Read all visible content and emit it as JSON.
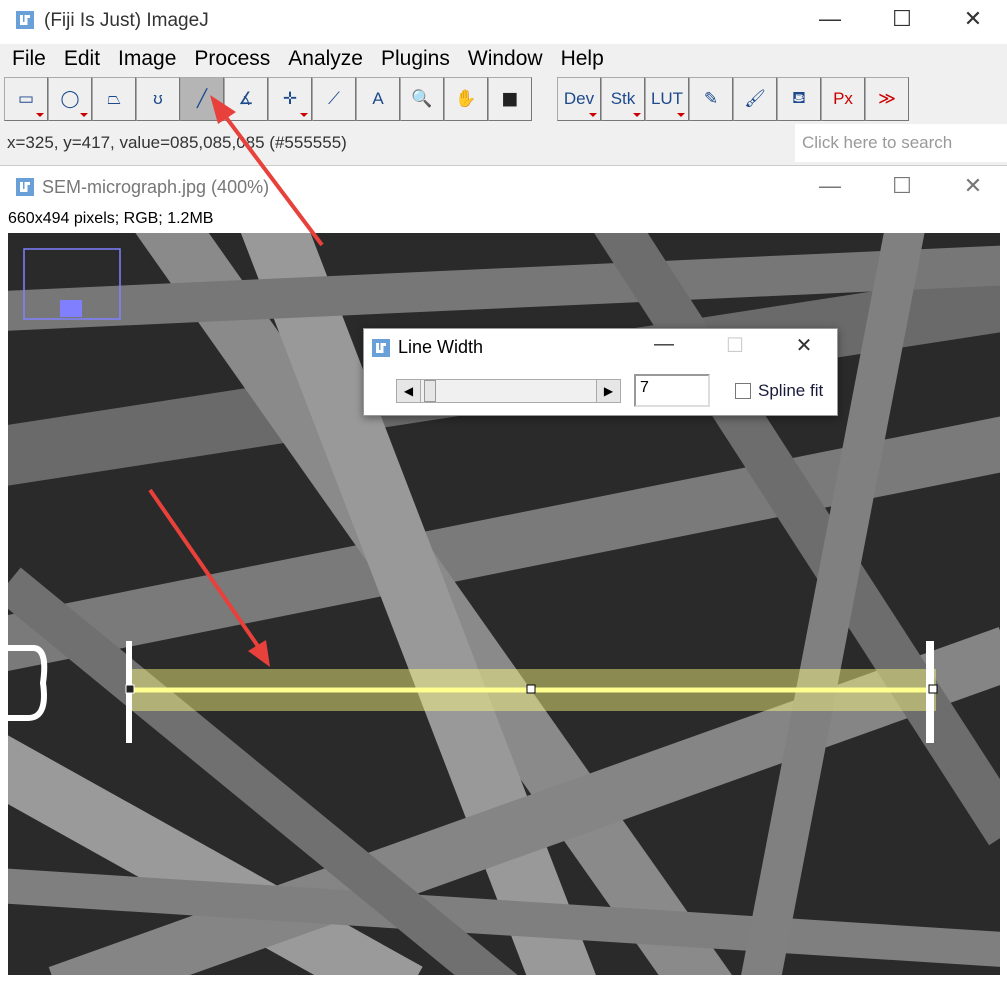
{
  "main_window": {
    "title": "(Fiji Is Just) ImageJ",
    "controls": {
      "minimize": "—",
      "maximize": "☐",
      "close": "✕"
    }
  },
  "menu": [
    "File",
    "Edit",
    "Image",
    "Process",
    "Analyze",
    "Plugins",
    "Window",
    "Help"
  ],
  "toolbar": [
    {
      "name": "rectangle-tool",
      "glyph": "▭",
      "dd": true
    },
    {
      "name": "oval-tool",
      "glyph": "◯",
      "dd": true
    },
    {
      "name": "polygon-tool",
      "glyph": "⏢",
      "dd": false
    },
    {
      "name": "freehand-tool",
      "glyph": "ʊ",
      "dd": false
    },
    {
      "name": "line-tool",
      "glyph": "╱",
      "dd": false,
      "selected": true
    },
    {
      "name": "angle-tool",
      "glyph": "∡",
      "dd": false
    },
    {
      "name": "multipoint-tool",
      "glyph": "✛",
      "dd": true
    },
    {
      "name": "wand-tool",
      "glyph": "⟋",
      "dd": false
    },
    {
      "name": "text-tool",
      "glyph": "A",
      "dd": false
    },
    {
      "name": "magnifier-tool",
      "glyph": "🔍",
      "dd": false
    },
    {
      "name": "hand-tool",
      "glyph": "✋",
      "dd": false
    },
    {
      "name": "color-picker-tool",
      "glyph": "■",
      "dd": false
    }
  ],
  "toolbar2": [
    {
      "name": "dev-menu",
      "glyph": "Dev",
      "dd": true
    },
    {
      "name": "stk-menu",
      "glyph": "Stk",
      "dd": true
    },
    {
      "name": "lut-menu",
      "glyph": "LUT",
      "dd": true
    },
    {
      "name": "pencil-tool",
      "glyph": "✎",
      "dd": false
    },
    {
      "name": "brush-tool",
      "glyph": "🖌",
      "dd": false
    },
    {
      "name": "flood-fill-tool",
      "glyph": "⛾",
      "dd": false
    },
    {
      "name": "pixel-inspector-tool",
      "glyph": "Px",
      "dd": false
    },
    {
      "name": "more-tools",
      "glyph": "≫",
      "dd": false
    }
  ],
  "status": "x=325, y=417, value=085,085,085 (#555555)",
  "search": {
    "placeholder": "Click here to search"
  },
  "image_window": {
    "title": "SEM-micrograph.jpg (400%)",
    "info": "660x494 pixels; RGB; 1.2MB"
  },
  "dialog": {
    "title": "Line Width",
    "value": "7",
    "slider_fraction": 0.02,
    "spline_label": "Spline fit",
    "spline_checked": false
  },
  "colors": {
    "accent": "#6aa0d8",
    "selection": "#ffff80",
    "arrow": "#e8403a"
  }
}
